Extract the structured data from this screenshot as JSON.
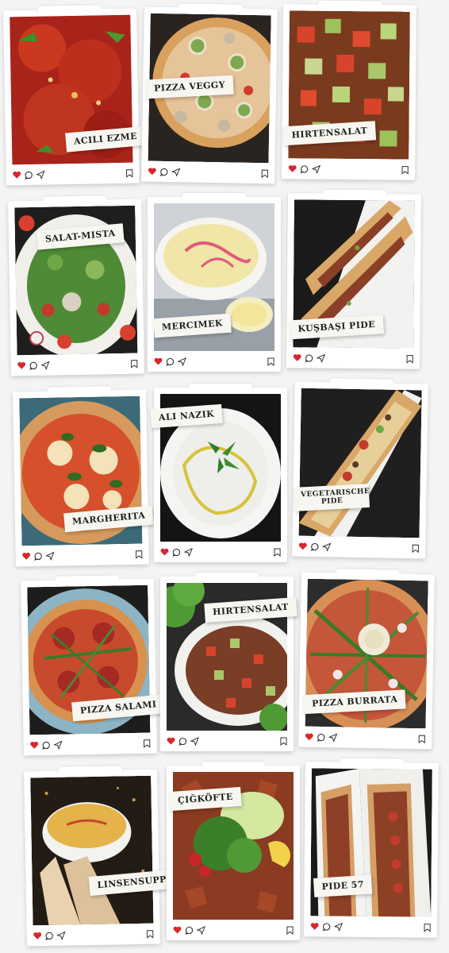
{
  "theme": {
    "heart_color": "#d8262c",
    "icon_color": "#333333",
    "background": "#f4f4f4"
  },
  "icons": [
    "heart-icon",
    "comment-icon",
    "share-icon",
    "bookmark-icon"
  ],
  "cards": [
    {
      "title": "ACILI EZME"
    },
    {
      "title": "PIZZA VEGGY"
    },
    {
      "title": "HIRTENSALAT"
    },
    {
      "title": "SALAT-MISTA"
    },
    {
      "title": "MERCIMEK"
    },
    {
      "title": "KUŞBAŞI PIDE"
    },
    {
      "title": "MARGHERITA"
    },
    {
      "title": "ALI NAZIK"
    },
    {
      "title": "VEGETARISCHE PIDE"
    },
    {
      "title": "PIZZA SALAMI"
    },
    {
      "title": "HIRTENSALAT"
    },
    {
      "title": "PIZZA BURRATA"
    },
    {
      "title": "LINSENSUPPE"
    },
    {
      "title": "ÇIĞKÖFTE"
    },
    {
      "title": "PIDE 57"
    }
  ]
}
